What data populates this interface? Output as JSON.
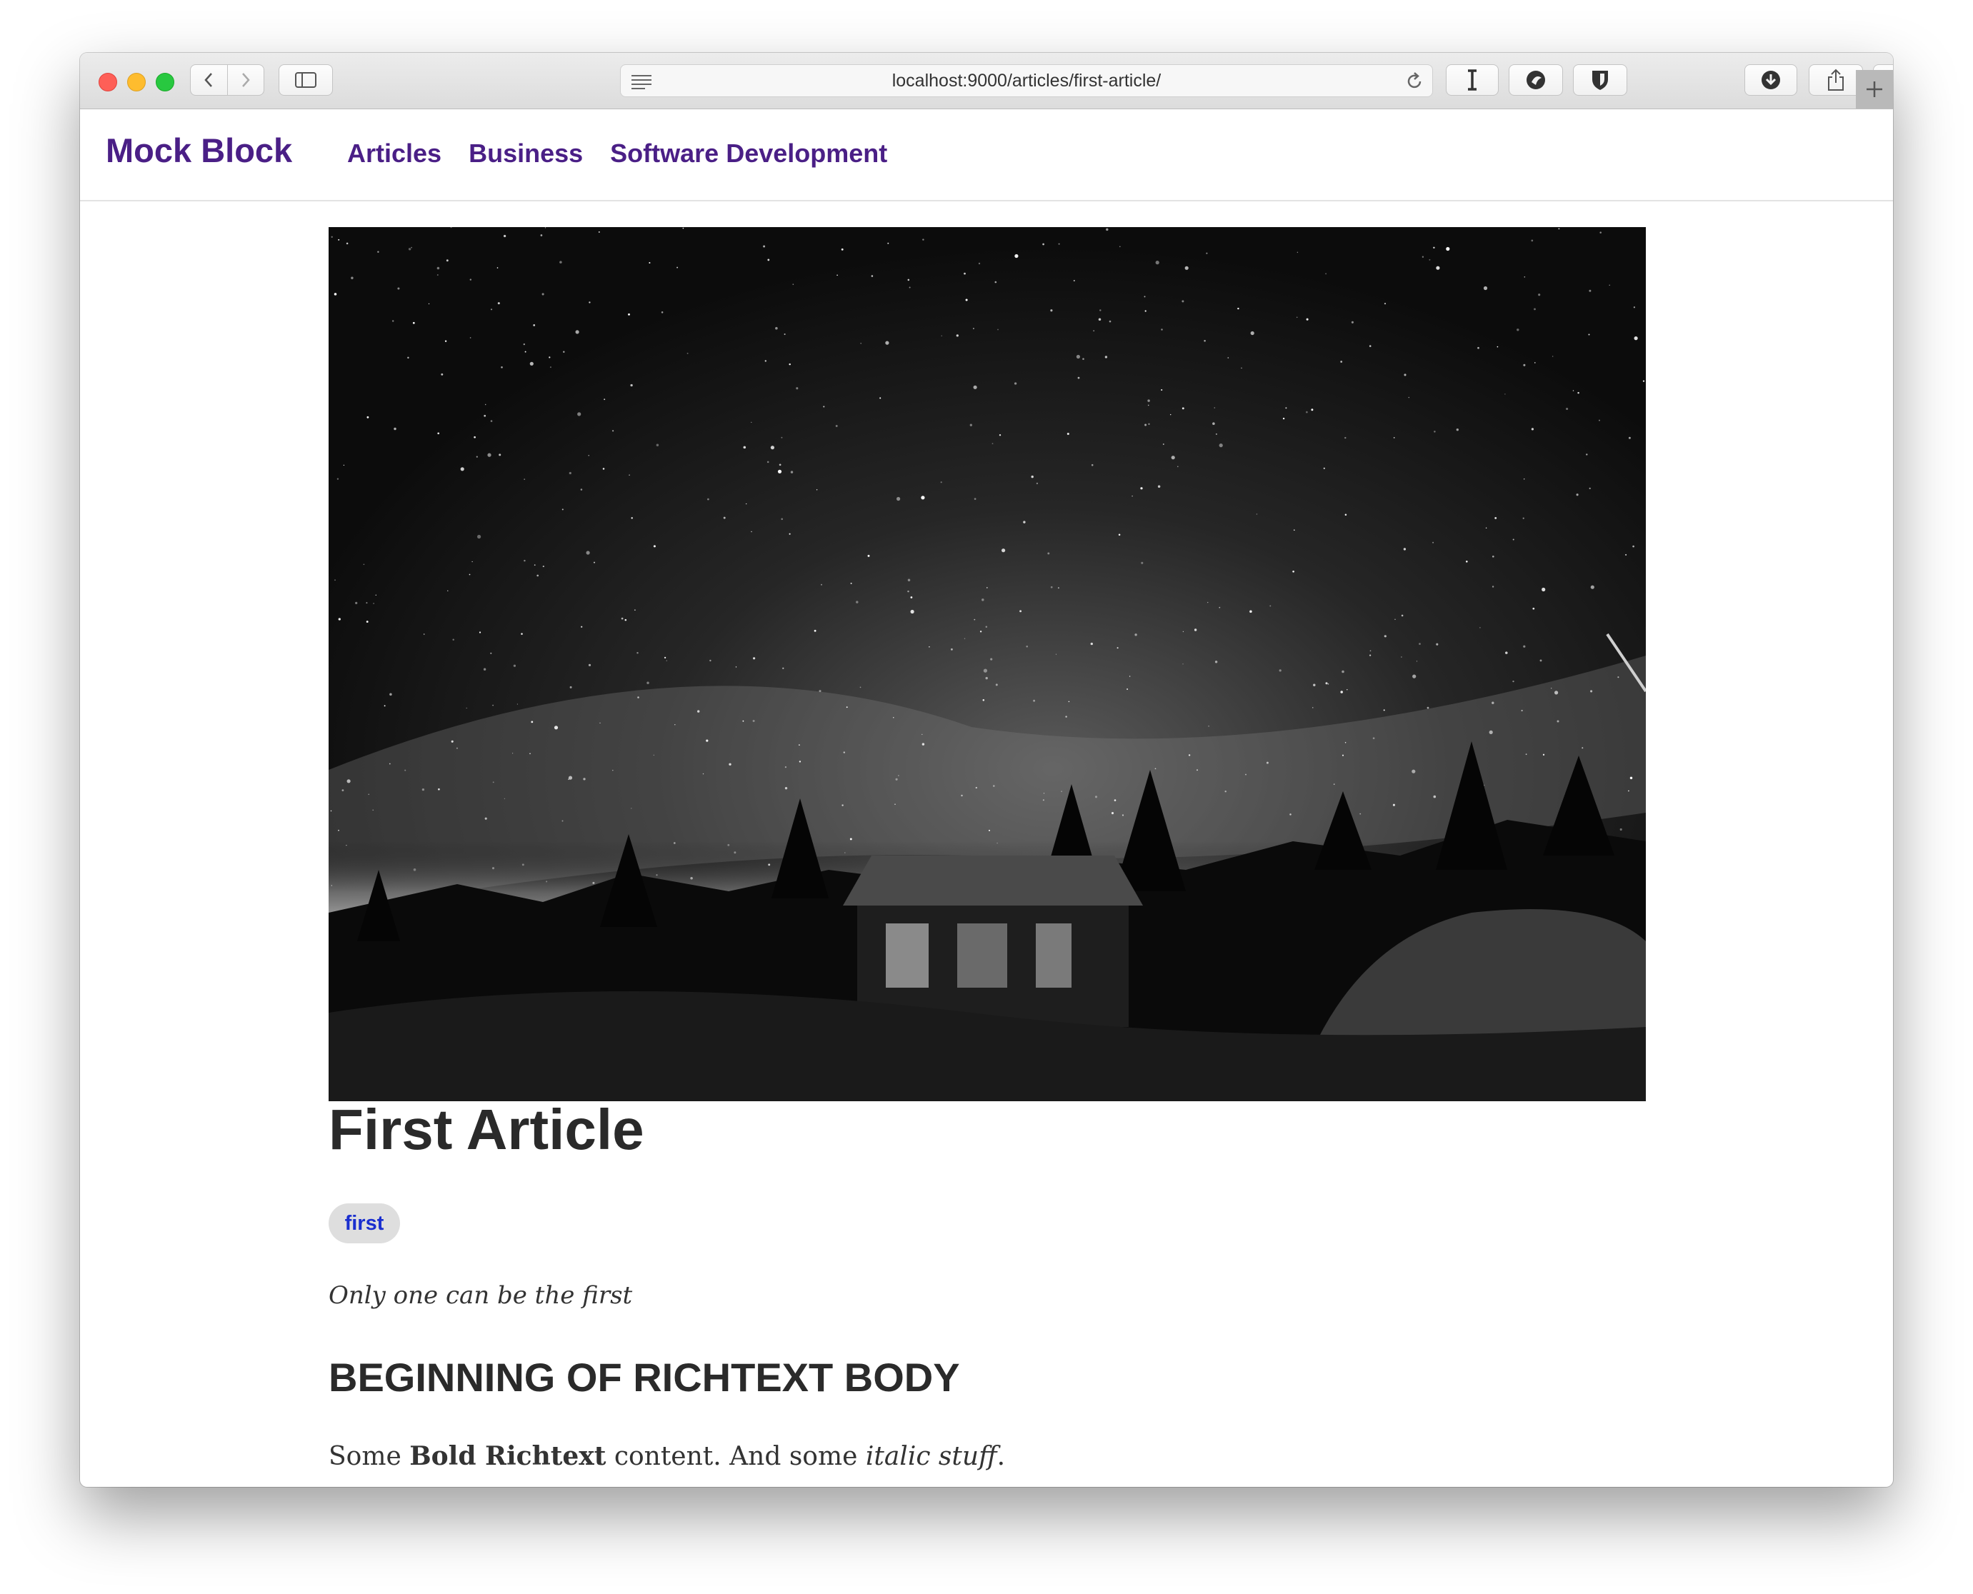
{
  "browser": {
    "url": "localhost:9000/articles/first-article/",
    "icons": [
      "back-icon",
      "forward-icon",
      "sidebar-icon",
      "reader-icon",
      "reload-icon",
      "text-cursor-extension-icon",
      "extension-icon",
      "shield-extension-icon",
      "download-icon",
      "share-icon",
      "tabs-icon",
      "new-tab-icon"
    ]
  },
  "site": {
    "brand": "Mock Block",
    "nav": [
      "Articles",
      "Business",
      "Software Development"
    ],
    "brand_color": "#4a1f86"
  },
  "article": {
    "title": "First Article",
    "tag": "first",
    "intro": "Only one can be the first",
    "heading": "BEGINNING OF RICHTEXT BODY",
    "para_prefix": "Some ",
    "para_bold": "Bold Richtext",
    "para_middle": " content. And some ",
    "para_italic": "italic stuff",
    "para_suffix": "."
  }
}
